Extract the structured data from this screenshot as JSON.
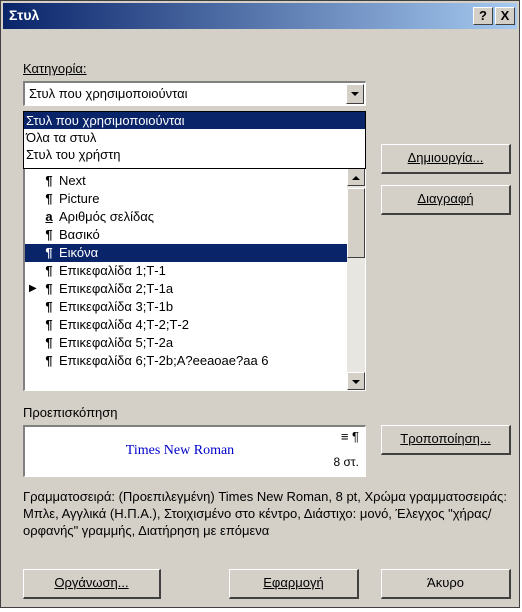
{
  "window": {
    "title": "Στυλ",
    "help_label": "?",
    "close_label": "X"
  },
  "category": {
    "label": "Κατηγορία:",
    "value": "Στυλ που χρησιμοποιούνται",
    "options": [
      "Στυλ που χρησιμοποιούνται",
      "Όλα τα στυλ",
      "Στυλ του χρήστη"
    ]
  },
  "styles": {
    "items": [
      {
        "mark": "¶",
        "name": "Next"
      },
      {
        "mark": "¶",
        "name": "Picture"
      },
      {
        "mark": "a",
        "name": "Αριθμός σελίδας"
      },
      {
        "mark": "¶",
        "name": "Βασικό"
      },
      {
        "mark": "¶",
        "name": "Εικόνα"
      },
      {
        "mark": "¶",
        "name": "Επικεφαλίδα 1;Τ-1"
      },
      {
        "mark": "¶",
        "name": "Επικεφαλίδα 2;Τ-1a"
      },
      {
        "mark": "¶",
        "name": "Επικεφαλίδα 3;Τ-1b"
      },
      {
        "mark": "¶",
        "name": "Επικεφαλίδα 4;Τ-2;Τ-2"
      },
      {
        "mark": "¶",
        "name": "Επικεφαλίδα 5;Τ-2a"
      },
      {
        "mark": "¶",
        "name": "Επικεφαλίδα 6;Τ-2b;A?eeaoae?aa 6"
      }
    ],
    "selected_index": 4,
    "pointer_index": 6
  },
  "preview": {
    "label": "Προεπισκόπηση",
    "font_sample": "Times New Roman",
    "size_text": "8 στ."
  },
  "description": "Γραμματοσειρά: (Προεπιλεγμένη) Times New Roman, 8 pt, Χρώμα γραμματοσειράς: Μπλε, Αγγλικά (Η.Π.Α.), Στοιχισμένο στο κέντρο, Διάστιχο: μονό, Έλεγχος \"χήρας/ορφανής\" γραμμής, Διατήρηση με επόμενα",
  "buttons": {
    "new": "Δημιουργία...",
    "delete": "Διαγραφή",
    "modify": "Τροποποίηση...",
    "organizer": "Οργάνωση...",
    "apply": "Εφαρμογή",
    "cancel": "Άκυρο"
  },
  "colors": {
    "title_bar": "#0a246a",
    "selection": "#0a246a",
    "preview_text": "#0000cc",
    "dialog_bg": "#d4d0c8"
  }
}
